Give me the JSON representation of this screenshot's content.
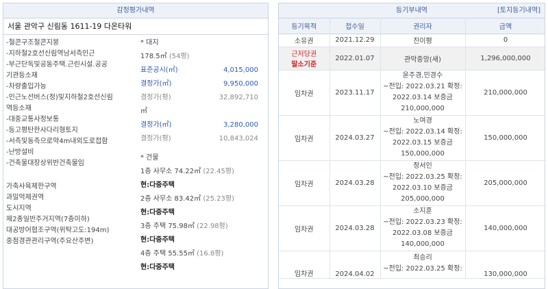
{
  "left": {
    "header": "감정평가내역",
    "address": "서울 관악구 신림동 1611-19 다온타워",
    "features": [
      "-철콘구조철콘지붕",
      "-지하철2호선신림역남서측인근",
      "-부근단독및공동주택.근린시설.공공",
      "기관등소재",
      "-차량출입가능",
      "-인근노선버스(정)및지하철2호선신림",
      "역등소재",
      "-대중교통사정보통",
      "-등고평탄한사다리형토지",
      "-서측및동측으로약4m내외도로접함",
      "-난방설비",
      "-건축물대장상위반건축물임"
    ],
    "zoning": [
      "가축사육제한구역",
      "과밀억제권역",
      "도시지역",
      "제2종일반주거지역(7층이하)",
      "대공방어협조구역(위탁고도:194m)",
      "중점경관관리구역(주요산주변)"
    ],
    "land_label": "* 대지",
    "land_area": "178.5㎡",
    "land_pyeong": "(54평)",
    "official_price_label": "표준공시(㎡)",
    "official_price_value": "4,015,000",
    "decided_price_label": "결정가(㎡)",
    "decided_price_value": "9,950,000",
    "decided_pyeong_label": "결정가(평)",
    "decided_pyeong_value": "32,892,710",
    "unit_sqm": "㎡",
    "decided2_label": "결정가(㎡)",
    "decided2_value": "3,280,000",
    "decided2_pyeong_label": "결정가(평)",
    "decided2_pyeong_value": "10,843,024",
    "building_label": "* 건물",
    "floors": [
      {
        "desc": "1층 사무소 74.22㎡",
        "pyeong": "(22.45평)",
        "current": "현:다중주택"
      },
      {
        "desc": "2층 사무소 83.42㎡",
        "pyeong": "(25.23평)",
        "current": "현:다중주택"
      },
      {
        "desc": "3층 주택 75.98㎡",
        "pyeong": "(22.98평)",
        "current": "현:다중주택"
      },
      {
        "desc": "4층 주택 55.55㎡",
        "pyeong": "(16.8평)",
        "current": "현:다중주택"
      }
    ]
  },
  "right": {
    "header": "등기부내역",
    "header_link": "[토지등기내역]",
    "columns": [
      "등기목적",
      "접수일",
      "권리자",
      "금액"
    ],
    "rows": [
      {
        "purpose": "소유권",
        "date": "2021.12.29",
        "holder": "진이평",
        "amount": "0"
      },
      {
        "purpose": "근저당권",
        "purpose_note": "말소기준",
        "date": "2022.01.07",
        "holder": "관악중앙(새)",
        "amount": "1,296,000,000"
      },
      {
        "purpose": "임차권",
        "date": "2023.11.17",
        "holder_lines": [
          "윤주경,민경수",
          "~전입: 2022.03.21 확정:",
          "2022.03.14 보증금",
          "210,000,000"
        ],
        "amount": "210,000,000"
      },
      {
        "purpose": "임차권",
        "date": "2024.03.27",
        "holder_lines": [
          "노여경",
          "~전입: 2022.03.14 확정:",
          "2022.03.15 보증금",
          "150,000,000"
        ],
        "amount": "150,000,000"
      },
      {
        "purpose": "임차권",
        "date": "2024.03.28",
        "holder_lines": [
          "정서인",
          "~전입: 2022.03.25 확정:",
          "2022.03.10 보증금",
          "205,000,000"
        ],
        "amount": "205,000,000"
      },
      {
        "purpose": "임차권",
        "date": "2024.03.28",
        "holder_lines": [
          "소지훈",
          "~전입: 2022.03.23 확정:",
          "2022.03.08 보증금",
          "140,000,000"
        ],
        "amount": "140,000,000"
      },
      {
        "purpose": "임차권",
        "date": "2024.04.02",
        "holder_lines": [
          "최승리",
          "~전입: 2022.03.25 확정:"
        ],
        "amount": "130,000,000"
      }
    ]
  }
}
